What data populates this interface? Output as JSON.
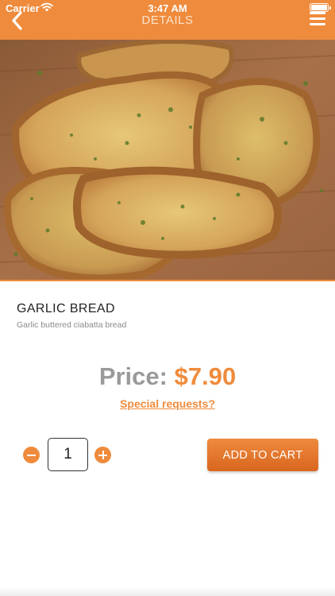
{
  "status_bar": {
    "carrier": "Carrier",
    "time": "3:47 AM"
  },
  "header": {
    "title": "DETAILS",
    "back_icon": "chevron-left-icon",
    "menu_icon": "hamburger-menu-icon"
  },
  "item": {
    "name": "GARLIC BREAD",
    "description": "Garlic buttered ciabatta bread",
    "image_alt": "garlic bread"
  },
  "price": {
    "label": "Price:",
    "value": "$7.90"
  },
  "special_requests_label": "Special requests?",
  "quantity": {
    "value": "1",
    "minus_icon": "minus-circle-icon",
    "plus_icon": "plus-circle-icon"
  },
  "add_to_cart_label": "ADD TO CART",
  "colors": {
    "accent": "#EF8B3C",
    "button_dark": "#D9661E",
    "price_label": "#9a9a9a"
  }
}
